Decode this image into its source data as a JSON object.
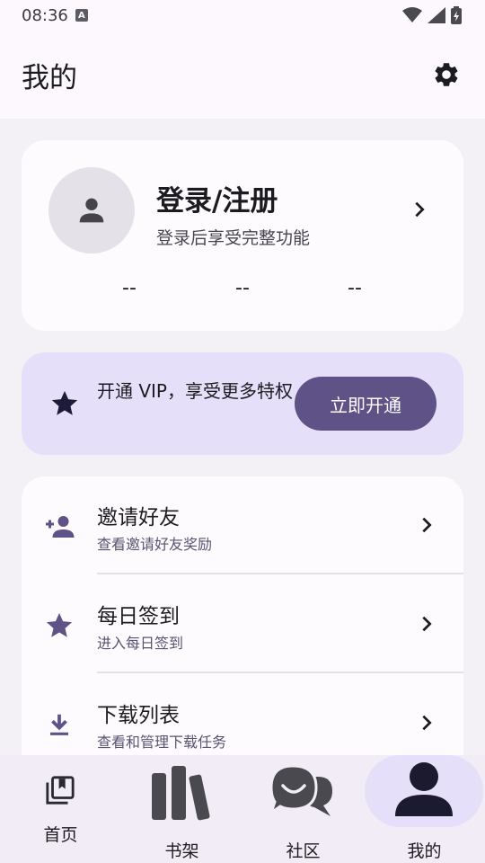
{
  "status_bar": {
    "time": "08:36",
    "badge": "A"
  },
  "app_bar": {
    "title": "我的",
    "settings_icon": "gear-icon"
  },
  "profile": {
    "name": "登录/注册",
    "subtitle": "登录后享受完整功能",
    "stats": [
      "--",
      "--",
      "--"
    ]
  },
  "vip": {
    "text": "开通 VIP，享受更多特权",
    "button": "立即开通"
  },
  "menu": [
    {
      "icon": "person-add-icon",
      "title": "邀请好友",
      "subtitle": "查看邀请好友奖励"
    },
    {
      "icon": "star-icon",
      "title": "每日签到",
      "subtitle": "进入每日签到"
    },
    {
      "icon": "download-icon",
      "title": "下载列表",
      "subtitle": "查看和管理下载任务"
    }
  ],
  "bottom_nav": [
    {
      "icon": "library-icon",
      "label": "首页"
    },
    {
      "icon": "bookshelf-icon",
      "label": "书架"
    },
    {
      "icon": "chat-bubbles-icon",
      "label": "社区"
    },
    {
      "icon": "person-icon",
      "label": "我的",
      "selected": true
    }
  ],
  "colors": {
    "primary": "#5f5287",
    "vip_bg": "#e6dffa",
    "surface": "#fefbff",
    "background": "#f4f1f6"
  }
}
